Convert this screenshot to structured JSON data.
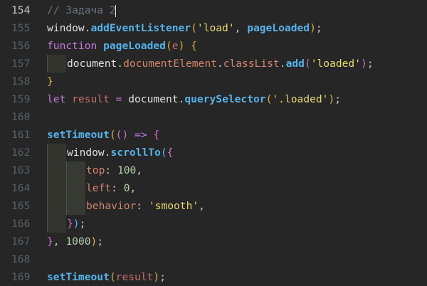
{
  "editor": {
    "active_line": "154",
    "lines": [
      {
        "no": "154",
        "tokens": [
          {
            "t": "// Задача 2",
            "c": "comment"
          }
        ]
      },
      {
        "no": "155",
        "tokens": [
          {
            "t": "window",
            "c": "ident"
          },
          {
            "t": ".",
            "c": "punc"
          },
          {
            "t": "addEventListener",
            "c": "method"
          },
          {
            "t": "(",
            "c": "paren"
          },
          {
            "t": "'load'",
            "c": "str"
          },
          {
            "t": ", ",
            "c": "punc"
          },
          {
            "t": "pageLoaded",
            "c": "method"
          },
          {
            "t": ")",
            "c": "paren"
          },
          {
            "t": ";",
            "c": "punc"
          }
        ]
      },
      {
        "no": "156",
        "tokens": [
          {
            "t": "function",
            "c": "kw"
          },
          {
            "t": " ",
            "c": "punc"
          },
          {
            "t": "pageLoaded",
            "c": "fn"
          },
          {
            "t": "(",
            "c": "paren"
          },
          {
            "t": "e",
            "c": "param"
          },
          {
            "t": ")",
            "c": "paren"
          },
          {
            "t": " {",
            "c": "paren"
          }
        ]
      },
      {
        "no": "157",
        "indent": 1,
        "tokens": [
          {
            "t": "document",
            "c": "ident"
          },
          {
            "t": ".",
            "c": "punc"
          },
          {
            "t": "documentElement",
            "c": "prop"
          },
          {
            "t": ".",
            "c": "punc"
          },
          {
            "t": "classList",
            "c": "prop"
          },
          {
            "t": ".",
            "c": "punc"
          },
          {
            "t": "add",
            "c": "method"
          },
          {
            "t": "(",
            "c": "paren2"
          },
          {
            "t": "'loaded'",
            "c": "str"
          },
          {
            "t": ")",
            "c": "paren2"
          },
          {
            "t": ";",
            "c": "punc"
          }
        ]
      },
      {
        "no": "158",
        "tokens": [
          {
            "t": "}",
            "c": "paren"
          }
        ]
      },
      {
        "no": "159",
        "tokens": [
          {
            "t": "let",
            "c": "kw"
          },
          {
            "t": " ",
            "c": "punc"
          },
          {
            "t": "result",
            "c": "param"
          },
          {
            "t": " ",
            "c": "punc"
          },
          {
            "t": "=",
            "c": "op"
          },
          {
            "t": " ",
            "c": "punc"
          },
          {
            "t": "document",
            "c": "ident"
          },
          {
            "t": ".",
            "c": "punc"
          },
          {
            "t": "querySelector",
            "c": "method"
          },
          {
            "t": "(",
            "c": "paren"
          },
          {
            "t": "'.loaded'",
            "c": "str"
          },
          {
            "t": ")",
            "c": "paren"
          },
          {
            "t": ";",
            "c": "punc"
          }
        ]
      },
      {
        "no": "160",
        "tokens": []
      },
      {
        "no": "161",
        "tokens": [
          {
            "t": "setTimeout",
            "c": "method"
          },
          {
            "t": "(",
            "c": "paren"
          },
          {
            "t": "()",
            "c": "paren2"
          },
          {
            "t": " ",
            "c": "punc"
          },
          {
            "t": "=>",
            "c": "op"
          },
          {
            "t": " {",
            "c": "paren2"
          }
        ]
      },
      {
        "no": "162",
        "indent": 1,
        "tokens": [
          {
            "t": "window",
            "c": "ident"
          },
          {
            "t": ".",
            "c": "punc"
          },
          {
            "t": "scrollTo",
            "c": "method"
          },
          {
            "t": "(",
            "c": "call"
          },
          {
            "t": "{",
            "c": "paren2"
          }
        ]
      },
      {
        "no": "163",
        "indent": 2,
        "tokens": [
          {
            "t": "top",
            "c": "prop"
          },
          {
            "t": ": ",
            "c": "punc"
          },
          {
            "t": "100",
            "c": "num"
          },
          {
            "t": ",",
            "c": "punc"
          }
        ]
      },
      {
        "no": "164",
        "indent": 2,
        "tokens": [
          {
            "t": "left",
            "c": "prop"
          },
          {
            "t": ": ",
            "c": "punc"
          },
          {
            "t": "0",
            "c": "num"
          },
          {
            "t": ",",
            "c": "punc"
          }
        ]
      },
      {
        "no": "165",
        "indent": 2,
        "tokens": [
          {
            "t": "behavior",
            "c": "prop"
          },
          {
            "t": ": ",
            "c": "punc"
          },
          {
            "t": "'smooth'",
            "c": "str"
          },
          {
            "t": ",",
            "c": "punc"
          }
        ]
      },
      {
        "no": "166",
        "indent": 1,
        "tokens": [
          {
            "t": "}",
            "c": "paren2"
          },
          {
            "t": ")",
            "c": "call"
          },
          {
            "t": ";",
            "c": "punc"
          }
        ]
      },
      {
        "no": "167",
        "tokens": [
          {
            "t": "}",
            "c": "paren2"
          },
          {
            "t": ", ",
            "c": "punc"
          },
          {
            "t": "1000",
            "c": "num"
          },
          {
            "t": ")",
            "c": "paren"
          },
          {
            "t": ";",
            "c": "punc"
          }
        ]
      },
      {
        "no": "168",
        "tokens": []
      },
      {
        "no": "169",
        "tokens": [
          {
            "t": "setTimeout",
            "c": "method"
          },
          {
            "t": "(",
            "c": "paren"
          },
          {
            "t": "result",
            "c": "param"
          },
          {
            "t": ")",
            "c": "paren"
          },
          {
            "t": ";",
            "c": "punc"
          }
        ]
      }
    ]
  },
  "colors": {
    "background": "#262626",
    "line_number": "#5a5e63",
    "line_number_active": "#c8c8c8"
  }
}
